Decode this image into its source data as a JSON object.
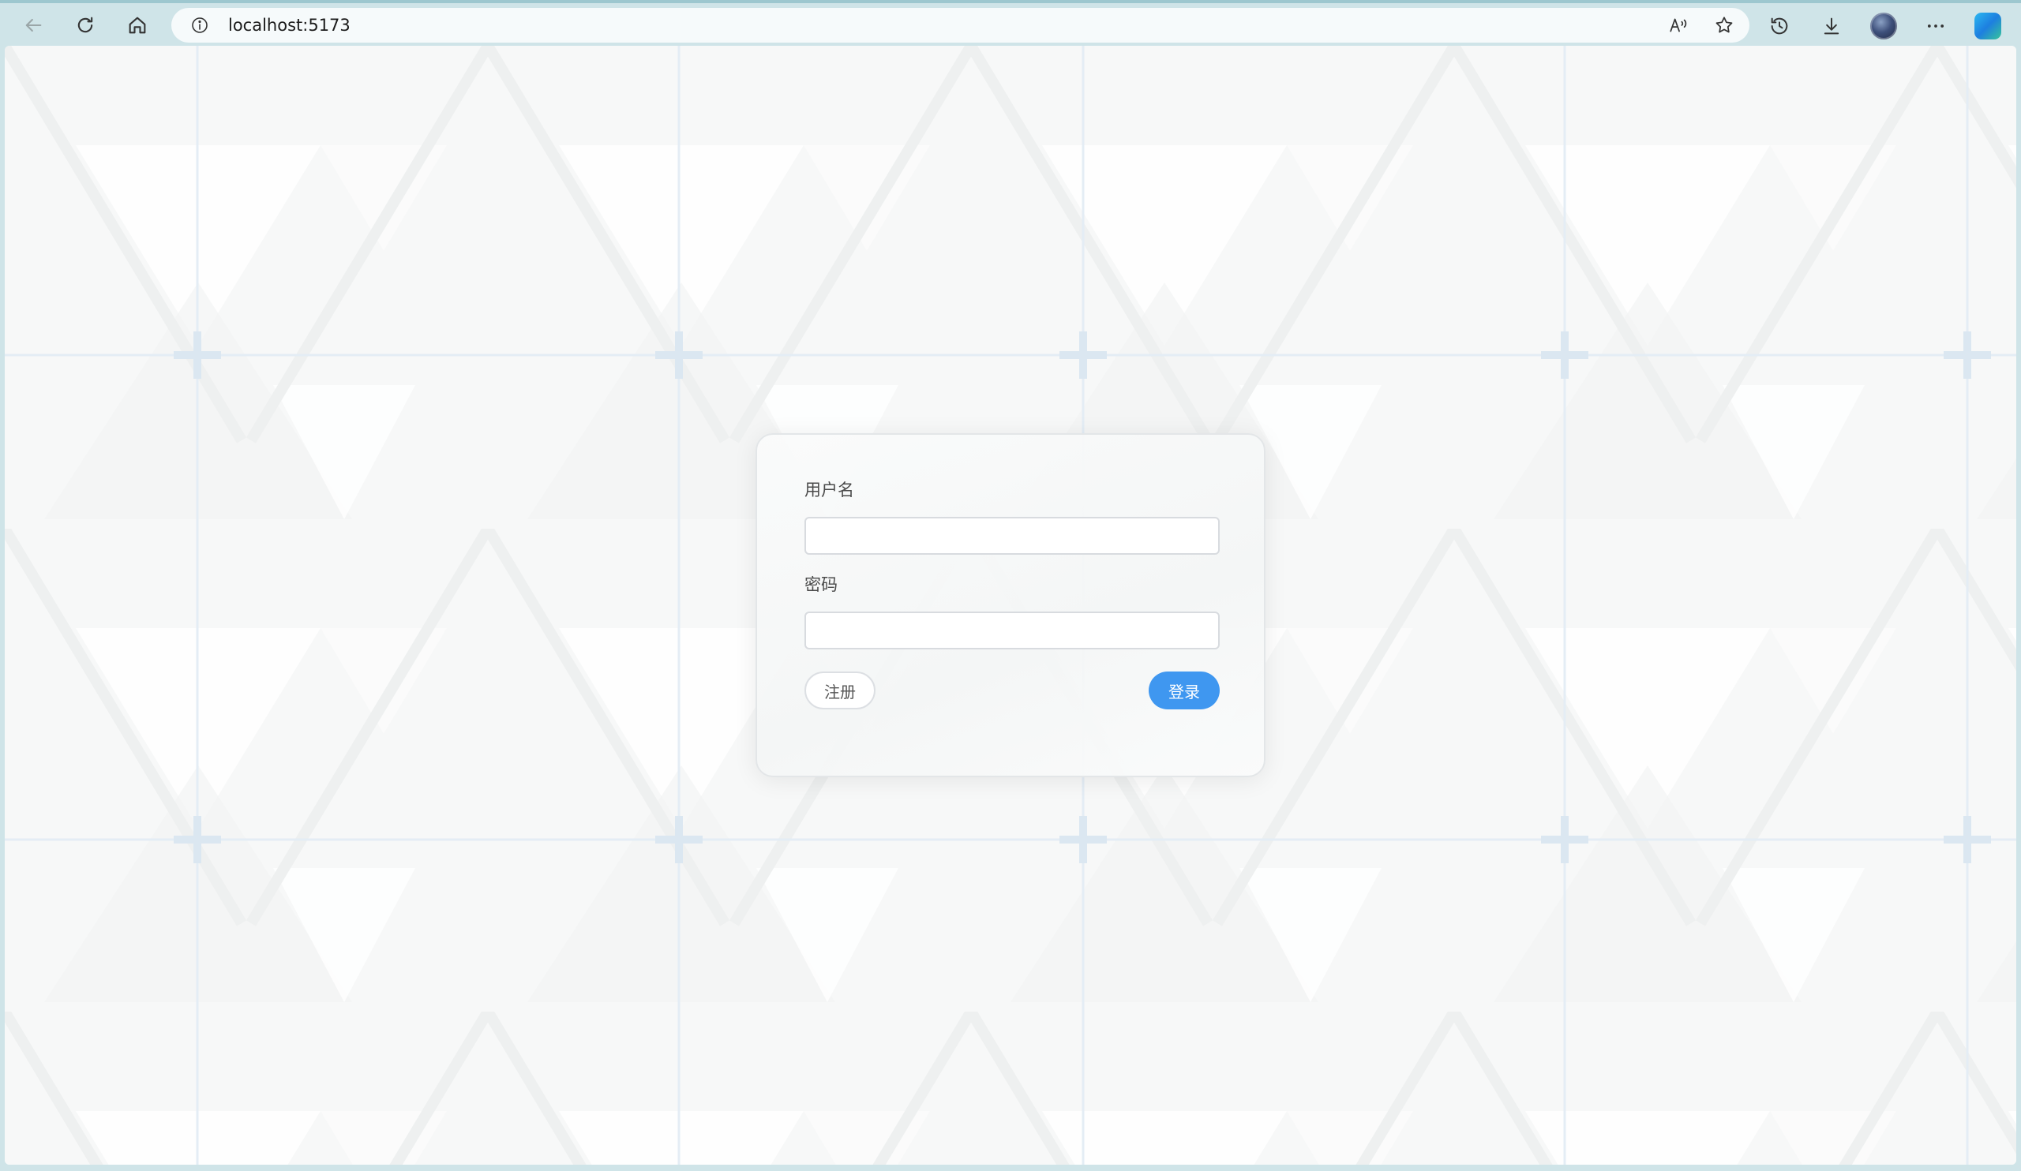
{
  "browser": {
    "url": "localhost:5173",
    "icons": {
      "back": "back-arrow-icon",
      "refresh": "refresh-icon",
      "home": "home-icon",
      "site_info": "info-icon",
      "read_aloud": "read-aloud-icon",
      "favorite": "star-icon",
      "history": "history-icon",
      "download": "download-icon",
      "profile": "avatar",
      "more": "more-icon",
      "copilot": "copilot-icon"
    }
  },
  "login": {
    "username_label": "用户名",
    "username_value": "",
    "password_label": "密码",
    "password_value": "",
    "register_label": "注册",
    "login_label": "登录"
  },
  "colors": {
    "primary": "#3f97f0",
    "chrome": "#cfe4e8",
    "background": "#f7f8f8"
  }
}
